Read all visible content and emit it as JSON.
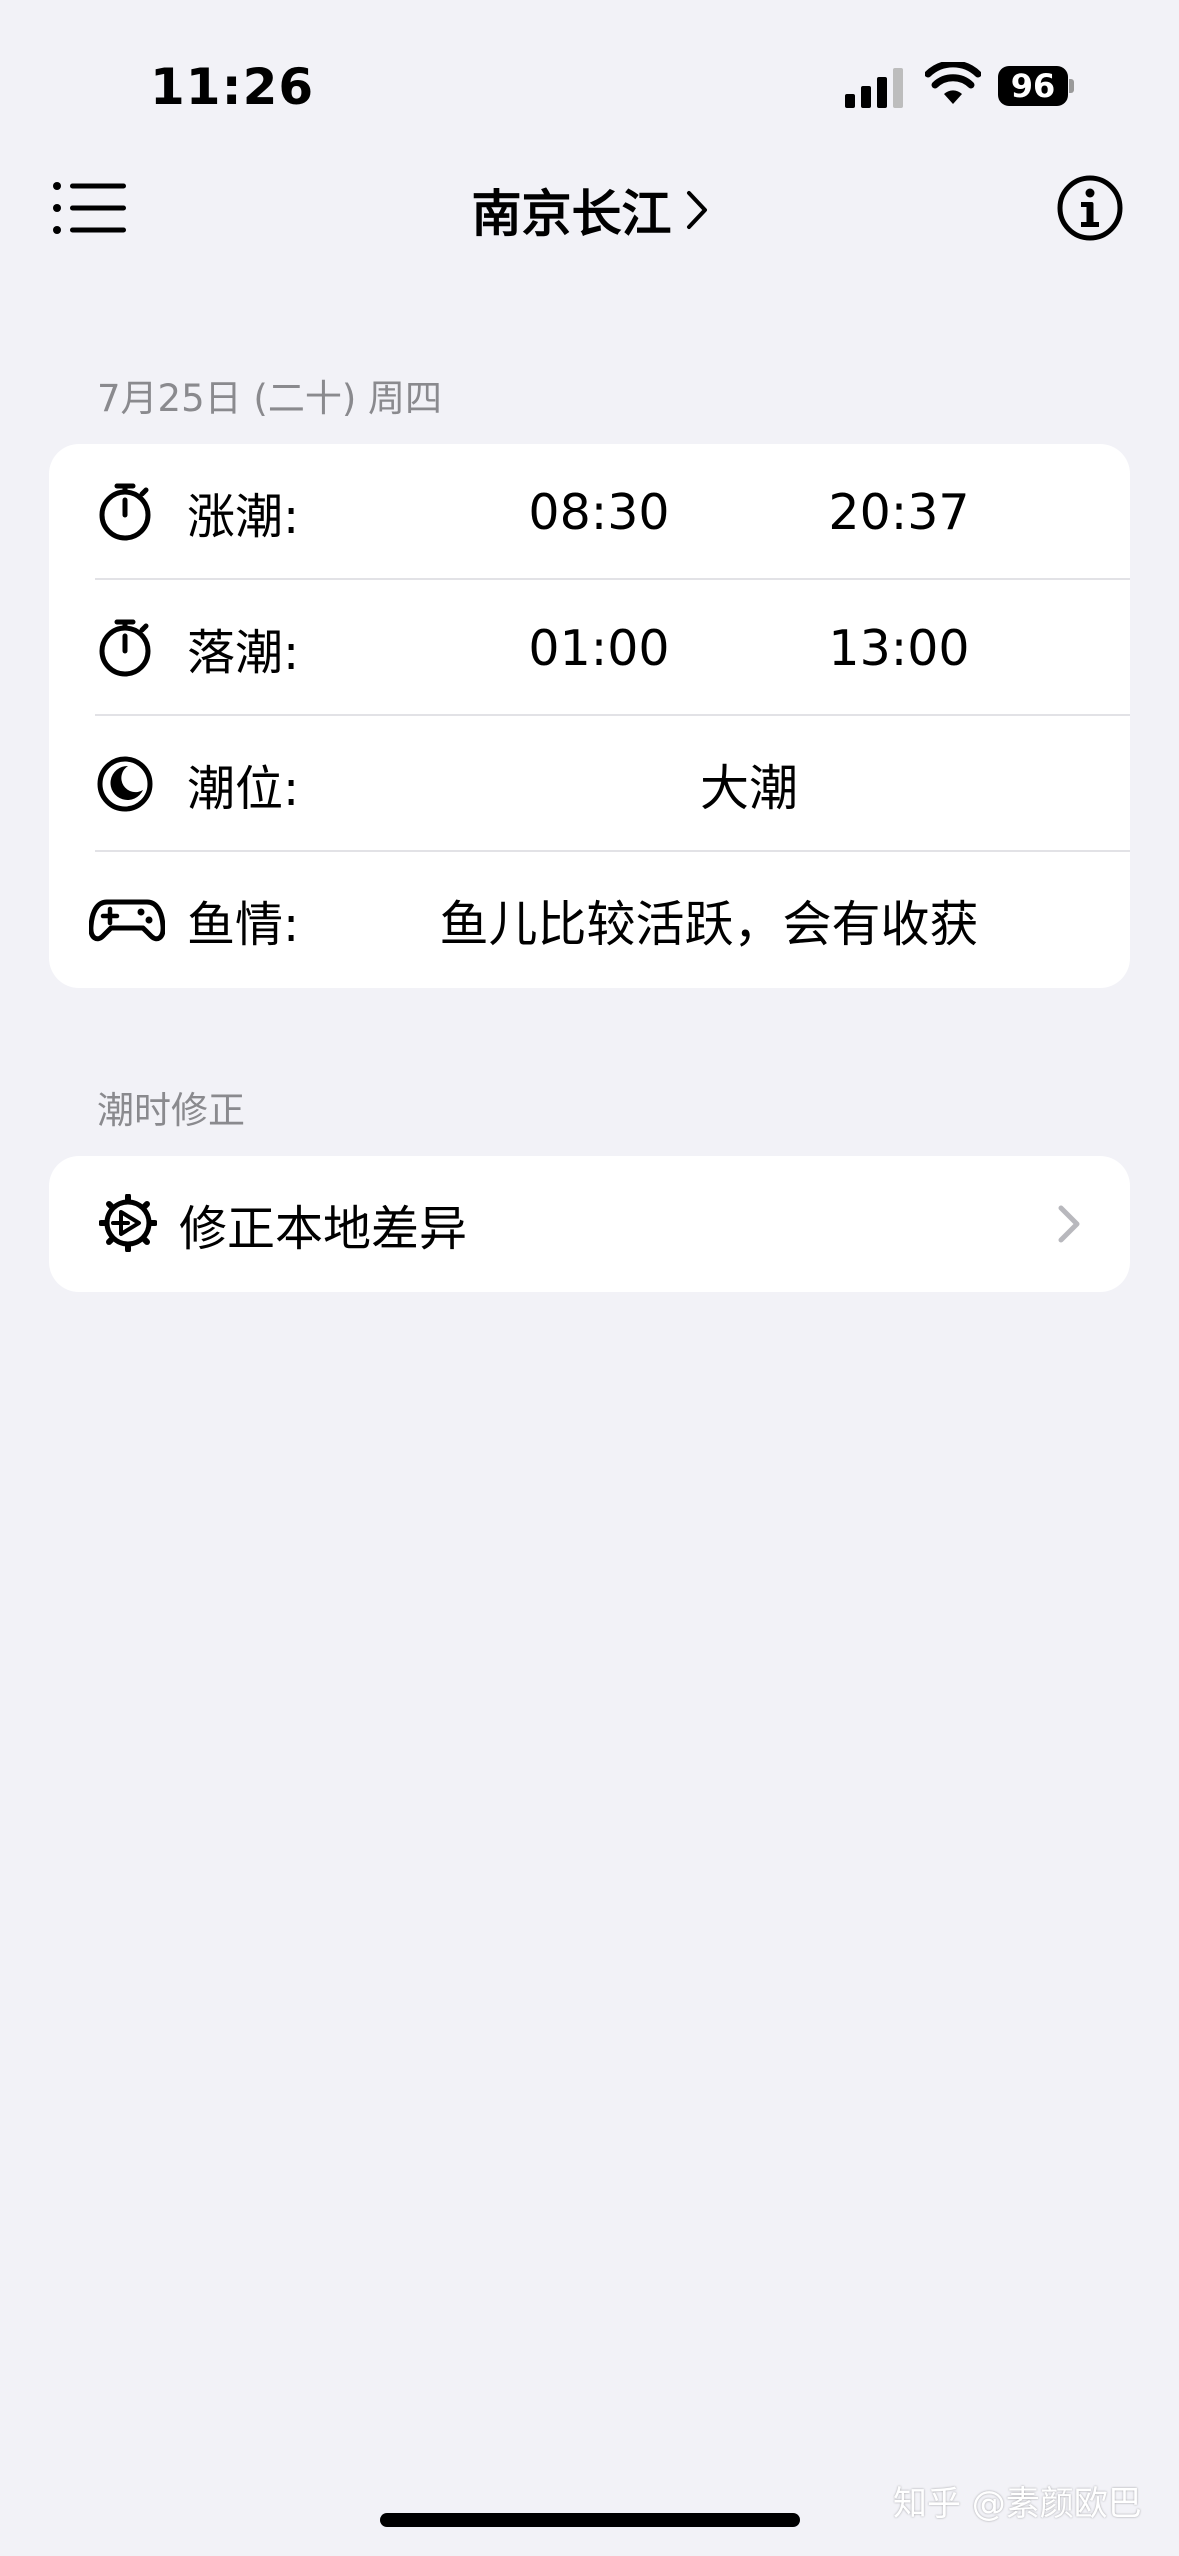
{
  "status_bar": {
    "time": "11:26",
    "battery": "96"
  },
  "nav": {
    "title": "南京长江",
    "left_icon": "list-icon",
    "right_icon": "info-icon"
  },
  "tide_section": {
    "header": "7月25日 (二十) 周四",
    "rows": [
      {
        "icon": "timer-icon",
        "label": "涨潮:",
        "values": [
          "08:30",
          "20:37"
        ]
      },
      {
        "icon": "timer-icon",
        "label": "落潮:",
        "values": [
          "01:00",
          "13:00"
        ]
      },
      {
        "icon": "moon-icon",
        "label": "潮位:",
        "value": "大潮"
      },
      {
        "icon": "gamecontroller-icon",
        "label": "鱼情:",
        "value": "鱼儿比较活跃，会有收获"
      }
    ]
  },
  "correction_section": {
    "header": "潮时修正",
    "item": {
      "icon": "gear-icon",
      "label": "修正本地差异"
    }
  },
  "watermark": "知乎 @素颜欧巴"
}
